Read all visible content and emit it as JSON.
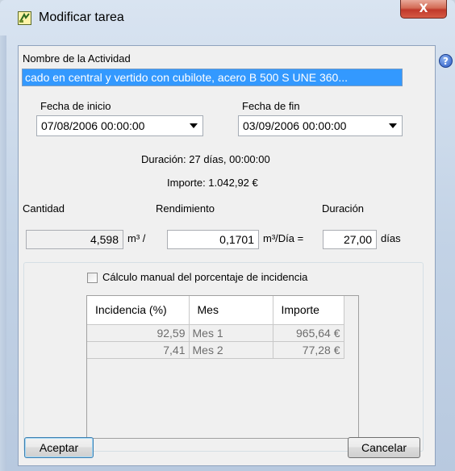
{
  "window": {
    "title": "Modificar tarea",
    "close_glyph": "X",
    "icon": "task-app-icon"
  },
  "activity": {
    "label": "Nombre de la Actividad",
    "value": "cado en central y vertido con cubilote, acero B 500 S UNE 360..."
  },
  "help": {
    "glyph": "?"
  },
  "dates": {
    "start_label": "Fecha de inicio",
    "start_value": "07/08/2006 00:00:00",
    "end_label": "Fecha de fin",
    "end_value": "03/09/2006 00:00:00"
  },
  "summary": {
    "duration": "Duración: 27 días, 00:00:00",
    "amount": "Importe: 1.042,92 €"
  },
  "quantity": {
    "cantidad_label": "Cantidad",
    "rendimiento_label": "Rendimiento",
    "duracion_label": "Duración",
    "cantidad_value": "4,598",
    "cantidad_unit": "m³ /",
    "rendimiento_value": "0,1701",
    "rendimiento_unit": "m³/Día =",
    "duracion_value": "27,00",
    "duracion_unit": "días"
  },
  "manual": {
    "checkbox_label": "Cálculo manual del porcentaje de incidencia",
    "checked": false
  },
  "table": {
    "headers": [
      "Incidencia (%)",
      "Mes",
      "Importe"
    ],
    "rows": [
      [
        "92,59",
        "Mes 1",
        "965,64 €"
      ],
      [
        "7,41",
        "Mes 2",
        "77,28 €"
      ]
    ]
  },
  "buttons": {
    "accept": "Aceptar",
    "cancel": "Cancelar"
  },
  "colors": {
    "selection": "#3399ff",
    "close": "#c0392b"
  }
}
